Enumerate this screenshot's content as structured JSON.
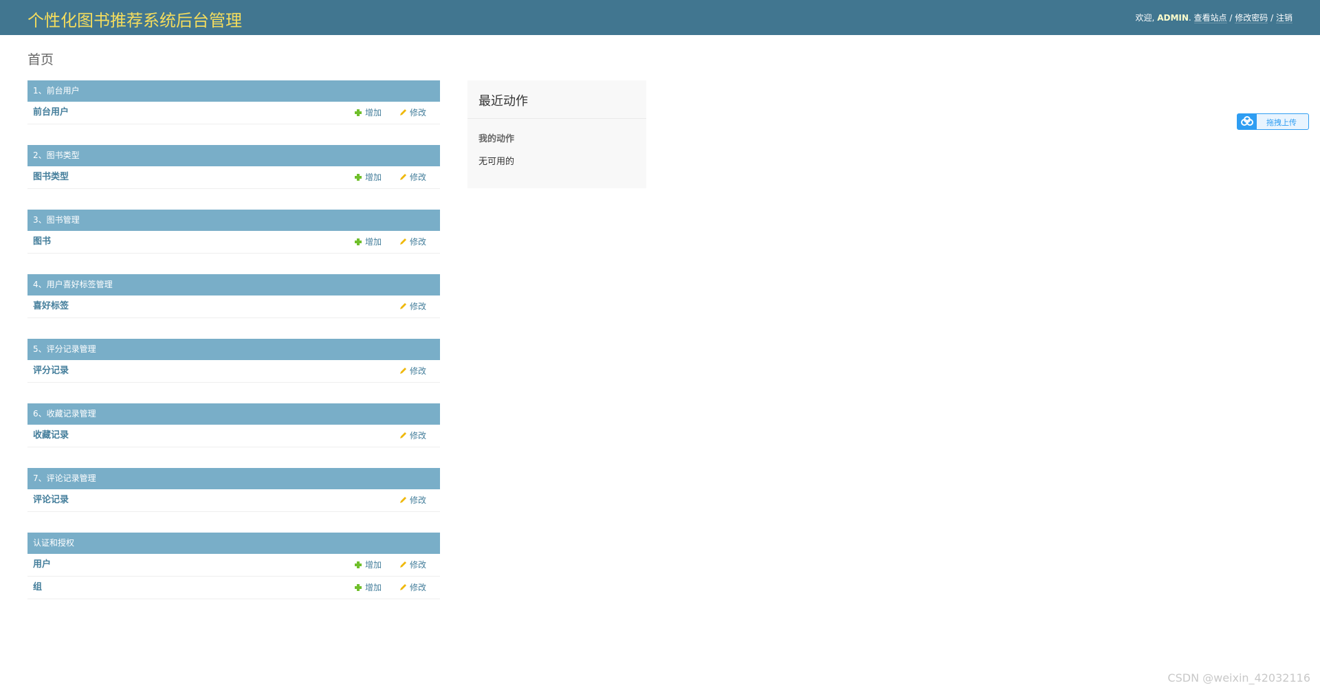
{
  "header": {
    "site_name": "个性化图书推荐系统后台管理",
    "welcome": "欢迎,",
    "username": "ADMIN",
    "view_site": "查看站点",
    "separator": "/",
    "change_password": "修改密码",
    "logout": "注销"
  },
  "page": {
    "title": "首页"
  },
  "modules": [
    {
      "title": "1、前台用户",
      "models": [
        {
          "name": "前台用户",
          "add": "增加",
          "change": "修改"
        }
      ]
    },
    {
      "title": "2、图书类型",
      "models": [
        {
          "name": "图书类型",
          "add": "增加",
          "change": "修改"
        }
      ]
    },
    {
      "title": "3、图书管理",
      "models": [
        {
          "name": "图书",
          "add": "增加",
          "change": "修改"
        }
      ]
    },
    {
      "title": "4、用户喜好标签管理",
      "models": [
        {
          "name": "喜好标签",
          "change": "修改"
        }
      ]
    },
    {
      "title": "5、评分记录管理",
      "models": [
        {
          "name": "评分记录",
          "change": "修改"
        }
      ]
    },
    {
      "title": "6、收藏记录管理",
      "models": [
        {
          "name": "收藏记录",
          "change": "修改"
        }
      ]
    },
    {
      "title": "7、评论记录管理",
      "models": [
        {
          "name": "评论记录",
          "change": "修改"
        }
      ]
    },
    {
      "title": "认证和授权",
      "models": [
        {
          "name": "用户",
          "add": "增加",
          "change": "修改"
        },
        {
          "name": "组",
          "add": "增加",
          "change": "修改"
        }
      ]
    }
  ],
  "recent_actions": {
    "title": "最近动作",
    "my_actions": "我的动作",
    "empty": "无可用的"
  },
  "upload_widget": {
    "label": "拖拽上传",
    "icon": "cloud-icon"
  },
  "watermark": "CSDN @weixin_42032116",
  "colors": {
    "header_bg": "#417690",
    "site_name": "#f5dd5d",
    "module_header_bg": "#79aec8",
    "link": "#447e9b",
    "add_icon": "#70bf2b",
    "change_icon": "#efb80b",
    "upload_accent": "#2e9df2"
  }
}
